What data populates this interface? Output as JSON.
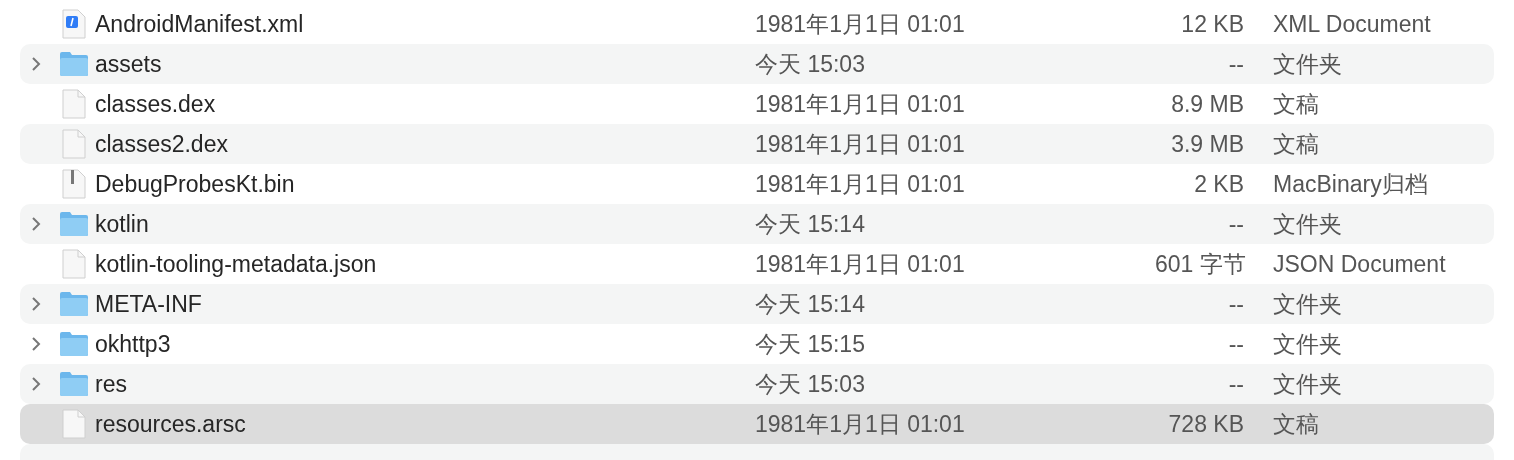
{
  "rows": [
    {
      "kind": "xml",
      "name": "AndroidManifest.xml",
      "date": "1981年1月1日 01:01",
      "size": "12 KB",
      "type": "XML Document",
      "selected": false
    },
    {
      "kind": "folder",
      "name": "assets",
      "date": "今天 15:03",
      "size": "--",
      "type": "文件夹",
      "selected": false
    },
    {
      "kind": "file",
      "name": "classes.dex",
      "date": "1981年1月1日 01:01",
      "size": "8.9 MB",
      "type": "文稿",
      "selected": false
    },
    {
      "kind": "file",
      "name": "classes2.dex",
      "date": "1981年1月1日 01:01",
      "size": "3.9 MB",
      "type": "文稿",
      "selected": false
    },
    {
      "kind": "binary",
      "name": "DebugProbesKt.bin",
      "date": "1981年1月1日 01:01",
      "size": "2 KB",
      "type": "MacBinary归档",
      "selected": false
    },
    {
      "kind": "folder",
      "name": "kotlin",
      "date": "今天 15:14",
      "size": "--",
      "type": "文件夹",
      "selected": false
    },
    {
      "kind": "file",
      "name": "kotlin-tooling-metadata.json",
      "date": "1981年1月1日 01:01",
      "size": "601 字节",
      "type": "JSON Document",
      "selected": false
    },
    {
      "kind": "folder",
      "name": "META-INF",
      "date": "今天 15:14",
      "size": "--",
      "type": "文件夹",
      "selected": false
    },
    {
      "kind": "folder",
      "name": "okhttp3",
      "date": "今天 15:15",
      "size": "--",
      "type": "文件夹",
      "selected": false
    },
    {
      "kind": "folder",
      "name": "res",
      "date": "今天 15:03",
      "size": "--",
      "type": "文件夹",
      "selected": false
    },
    {
      "kind": "file",
      "name": "resources.arsc",
      "date": "1981年1月1日 01:01",
      "size": "728 KB",
      "type": "文稿",
      "selected": true
    }
  ]
}
